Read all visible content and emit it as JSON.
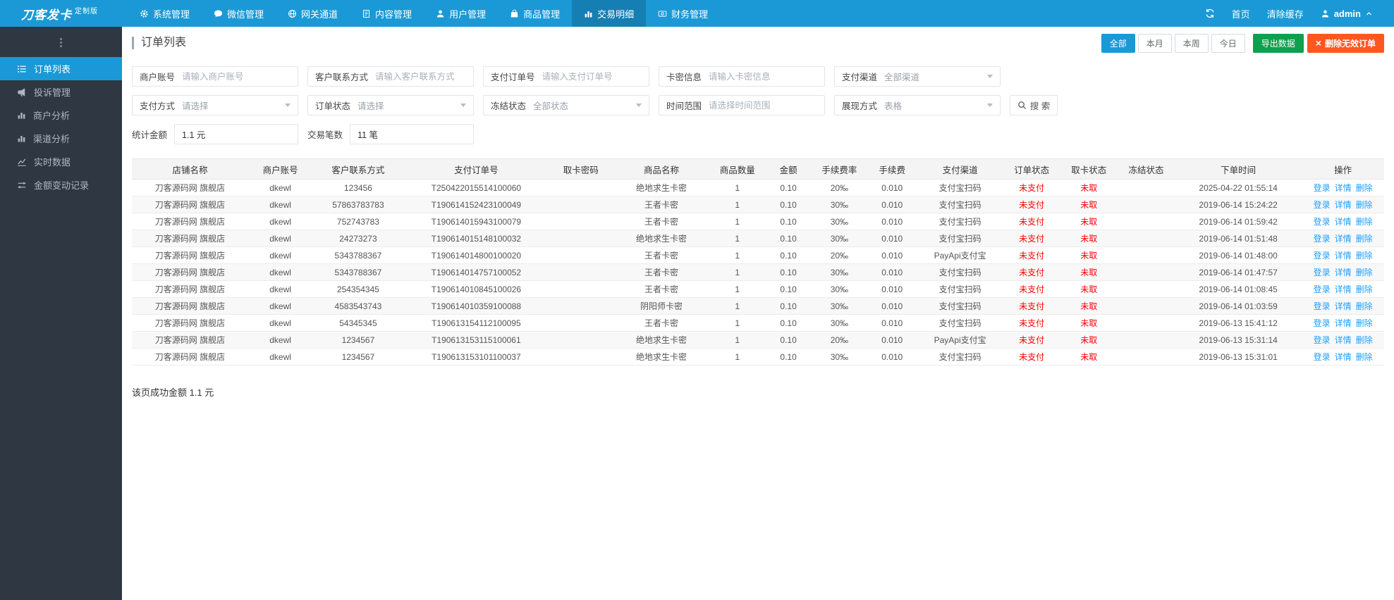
{
  "colors": {
    "primary": "#1b99d6",
    "primary_dark": "#157fb3",
    "sidebar_bg": "#2f3742",
    "sidebar_text": "#aeb6bf",
    "green": "#0fa04e",
    "danger": "#ff5722",
    "status_red": "#ff0000",
    "link": "#1e9fff",
    "border": "#e2e5ea"
  },
  "navbar": {
    "logo": "刀客发卡",
    "logo_badge": "定制版",
    "items": [
      {
        "name": "system",
        "icon": "gear-icon",
        "label": "系统管理"
      },
      {
        "name": "wechat",
        "icon": "wechat-icon",
        "label": "微信管理"
      },
      {
        "name": "gateway",
        "icon": "globe-icon",
        "label": "网关通道"
      },
      {
        "name": "content",
        "icon": "document-icon",
        "label": "内容管理"
      },
      {
        "name": "users",
        "icon": "user-group-icon",
        "label": "用户管理"
      },
      {
        "name": "products",
        "icon": "bag-icon",
        "label": "商品管理"
      },
      {
        "name": "transactions",
        "icon": "bar-chart-icon",
        "label": "交易明细",
        "active": true
      },
      {
        "name": "finance",
        "icon": "money-icon",
        "label": "财务管理"
      }
    ],
    "home": "首页",
    "clear_cache": "清除缓存",
    "username": "admin"
  },
  "sidebar": {
    "items": [
      {
        "name": "order-list",
        "icon": "list-icon",
        "label": "订单列表",
        "active": true
      },
      {
        "name": "complaints",
        "icon": "megaphone-icon",
        "label": "投诉管理"
      },
      {
        "name": "merchant-analysis",
        "icon": "chart-bars-icon",
        "label": "商户分析"
      },
      {
        "name": "channel-analysis",
        "icon": "chart-bars-icon",
        "label": "渠道分析"
      },
      {
        "name": "realtime-data",
        "icon": "line-chart-icon",
        "label": "实时数据"
      },
      {
        "name": "balance-changes",
        "icon": "exchange-icon",
        "label": "金额变动记录"
      }
    ]
  },
  "page": {
    "title": "订单列表",
    "range_buttons": [
      {
        "name": "all",
        "label": "全部",
        "active": true
      },
      {
        "name": "this-month",
        "label": "本月"
      },
      {
        "name": "this-week",
        "label": "本周"
      },
      {
        "name": "today",
        "label": "今日"
      }
    ],
    "export_label": "导出数据",
    "delete_invalid_label": "删除无效订单"
  },
  "filters": {
    "rows": [
      [
        {
          "name": "merchant-account",
          "label": "商户账号",
          "type": "text",
          "placeholder": "请输入商户账号"
        },
        {
          "name": "customer-contact",
          "label": "客户联系方式",
          "type": "text",
          "placeholder": "请输入客户联系方式"
        },
        {
          "name": "payment-order-no",
          "label": "支付订单号",
          "type": "text",
          "placeholder": "请输入支付订单号"
        },
        {
          "name": "card-info",
          "label": "卡密信息",
          "type": "text",
          "placeholder": "请输入卡密信息"
        },
        {
          "name": "payment-channel",
          "label": "支付渠道",
          "type": "select",
          "value": "全部渠道"
        }
      ],
      [
        {
          "name": "payment-method",
          "label": "支付方式",
          "type": "select",
          "value": "请选择"
        },
        {
          "name": "order-status",
          "label": "订单状态",
          "type": "select",
          "value": "请选择"
        },
        {
          "name": "freeze-status",
          "label": "冻结状态",
          "type": "select",
          "value": "全部状态"
        },
        {
          "name": "time-range",
          "label": "时间范围",
          "type": "text",
          "placeholder": "请选择时间范围"
        },
        {
          "name": "display-mode",
          "label": "展现方式",
          "type": "select",
          "value": "表格"
        }
      ]
    ],
    "search_label": "搜 索"
  },
  "stats": [
    {
      "name": "total-amount",
      "label": "统计金额",
      "value": "1.1 元"
    },
    {
      "name": "trade-count",
      "label": "交易笔数",
      "value": "11 笔"
    }
  ],
  "table": {
    "columns": [
      "店铺名称",
      "商户账号",
      "客户联系方式",
      "支付订单号",
      "取卡密码",
      "商品名称",
      "商品数量",
      "金额",
      "手续费率",
      "手续费",
      "支付渠道",
      "订单状态",
      "取卡状态",
      "冻结状态",
      "下单时间",
      "操作"
    ],
    "red_values": [
      "未支付",
      "未取"
    ],
    "actions": [
      "登录",
      "详情",
      "删除"
    ],
    "rows": [
      [
        "刀客源码网 旗舰店",
        "dkewl",
        "123456",
        "T250422015514100060",
        "",
        "绝地求生卡密",
        "1",
        "0.10",
        "20‰",
        "0.010",
        "支付宝扫码",
        "未支付",
        "未取",
        "",
        "2025-04-22 01:55:14"
      ],
      [
        "刀客源码网 旗舰店",
        "dkewl",
        "57863783783",
        "T190614152423100049",
        "",
        "王者卡密",
        "1",
        "0.10",
        "30‰",
        "0.010",
        "支付宝扫码",
        "未支付",
        "未取",
        "",
        "2019-06-14 15:24:22"
      ],
      [
        "刀客源码网 旗舰店",
        "dkewl",
        "752743783",
        "T190614015943100079",
        "",
        "王者卡密",
        "1",
        "0.10",
        "30‰",
        "0.010",
        "支付宝扫码",
        "未支付",
        "未取",
        "",
        "2019-06-14 01:59:42"
      ],
      [
        "刀客源码网 旗舰店",
        "dkewl",
        "24273273",
        "T190614015148100032",
        "",
        "绝地求生卡密",
        "1",
        "0.10",
        "30‰",
        "0.010",
        "支付宝扫码",
        "未支付",
        "未取",
        "",
        "2019-06-14 01:51:48"
      ],
      [
        "刀客源码网 旗舰店",
        "dkewl",
        "5343788367",
        "T190614014800100020",
        "",
        "王者卡密",
        "1",
        "0.10",
        "20‰",
        "0.010",
        "PayApi支付宝",
        "未支付",
        "未取",
        "",
        "2019-06-14 01:48:00"
      ],
      [
        "刀客源码网 旗舰店",
        "dkewl",
        "5343788367",
        "T190614014757100052",
        "",
        "王者卡密",
        "1",
        "0.10",
        "30‰",
        "0.010",
        "支付宝扫码",
        "未支付",
        "未取",
        "",
        "2019-06-14 01:47:57"
      ],
      [
        "刀客源码网 旗舰店",
        "dkewl",
        "254354345",
        "T190614010845100026",
        "",
        "王者卡密",
        "1",
        "0.10",
        "30‰",
        "0.010",
        "支付宝扫码",
        "未支付",
        "未取",
        "",
        "2019-06-14 01:08:45"
      ],
      [
        "刀客源码网 旗舰店",
        "dkewl",
        "4583543743",
        "T190614010359100088",
        "",
        "阴阳师卡密",
        "1",
        "0.10",
        "30‰",
        "0.010",
        "支付宝扫码",
        "未支付",
        "未取",
        "",
        "2019-06-14 01:03:59"
      ],
      [
        "刀客源码网 旗舰店",
        "dkewl",
        "54345345",
        "T190613154112100095",
        "",
        "王者卡密",
        "1",
        "0.10",
        "30‰",
        "0.010",
        "支付宝扫码",
        "未支付",
        "未取",
        "",
        "2019-06-13 15:41:12"
      ],
      [
        "刀客源码网 旗舰店",
        "dkewl",
        "1234567",
        "T190613153115100061",
        "",
        "绝地求生卡密",
        "1",
        "0.10",
        "20‰",
        "0.010",
        "PayApi支付宝",
        "未支付",
        "未取",
        "",
        "2019-06-13 15:31:14"
      ],
      [
        "刀客源码网 旗舰店",
        "dkewl",
        "1234567",
        "T190613153101100037",
        "",
        "绝地求生卡密",
        "1",
        "0.10",
        "30‰",
        "0.010",
        "支付宝扫码",
        "未支付",
        "未取",
        "",
        "2019-06-13 15:31:01"
      ]
    ]
  },
  "footer": {
    "summary": "该页成功金额 1.1 元"
  }
}
